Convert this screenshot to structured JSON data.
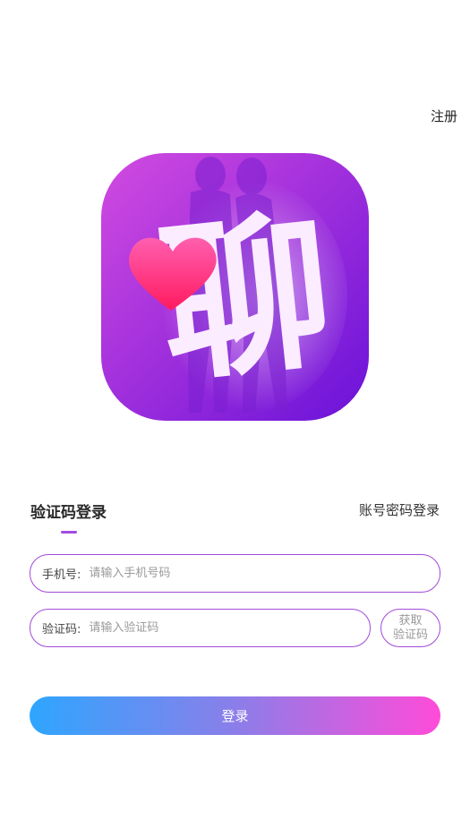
{
  "header": {
    "register_label": "注册"
  },
  "logo": {
    "glyph": "聊",
    "icon": "heart-icon",
    "colors": {
      "bg_start": "#d24be0",
      "bg_end": "#6a12d8",
      "heart": "#ff2f86",
      "glyph": "#fbecff"
    }
  },
  "tabs": {
    "active": "验证码登录",
    "inactive": "账号密码登录"
  },
  "phone": {
    "label": "手机号:",
    "placeholder": "请输入手机号码"
  },
  "code": {
    "label": "验证码:",
    "placeholder": "请输入验证码",
    "get_code_line1": "获取",
    "get_code_line2": "验证码"
  },
  "login": {
    "label": "登录"
  },
  "colors": {
    "accent": "#a24ad8",
    "gradient_start": "#2ea6ff",
    "gradient_end": "#ff4bd9"
  }
}
